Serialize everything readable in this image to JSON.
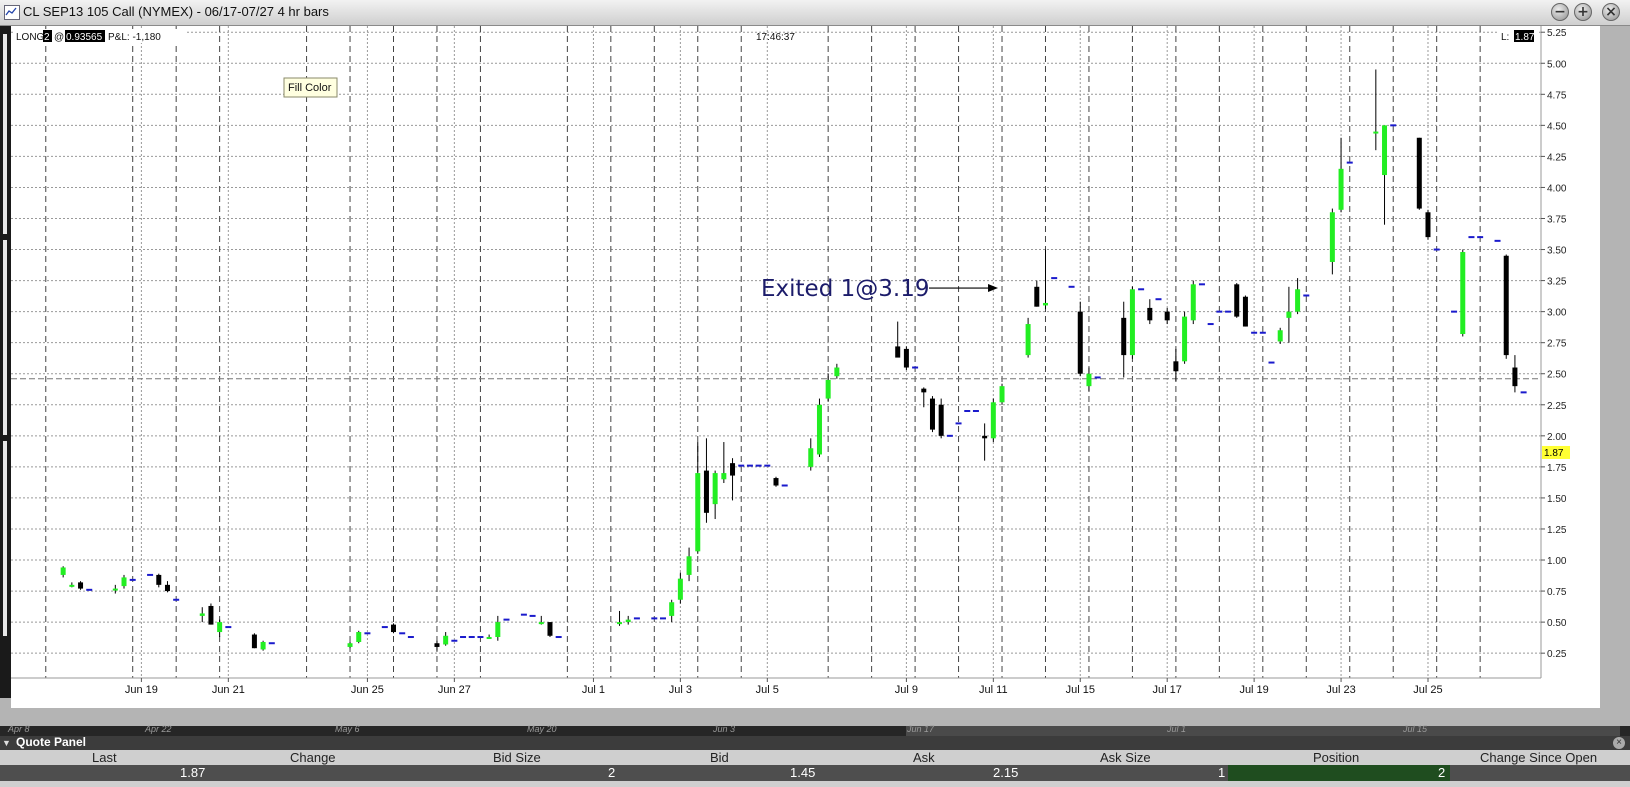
{
  "window": {
    "title": "CL SEP13 105 Call (NYMEX) - 06/17-07/27 4 hr bars",
    "buttons": {
      "minimize": "−",
      "maximize": "+",
      "close": "×"
    }
  },
  "chart_header": {
    "position_prefix": "LONG",
    "position_qty": "2",
    "at": "@",
    "avg_price": "0.93565",
    "pnl": "P&L: -1,180",
    "time": "17:46:37",
    "last_label": "L:",
    "last_value": "1.87"
  },
  "tooltip": "Fill Color",
  "annotation": {
    "text": "Exited 1@3.19",
    "x": 54,
    "y": 3.19
  },
  "chart_data": {
    "type": "candlestick",
    "y_ticks": [
      0.25,
      0.5,
      0.75,
      1.0,
      1.25,
      1.5,
      1.75,
      2.0,
      2.25,
      2.5,
      2.75,
      3.0,
      3.25,
      3.5,
      3.75,
      4.0,
      4.25,
      4.5,
      4.75,
      5.0,
      5.25
    ],
    "y_tick_labels": [
      "0.25",
      "0.50",
      "0.75",
      "1.00",
      "1.25",
      "1.50",
      "1.75",
      "2.00",
      "2.25",
      "2.50",
      "2.75",
      "3.00",
      "3.25",
      "3.50",
      "3.75",
      "4.00",
      "4.25",
      "4.50",
      "4.75",
      "5.00",
      "5.25"
    ],
    "ylim": [
      0.05,
      5.3
    ],
    "x_range": [
      -3,
      85
    ],
    "x_tick_labels": [
      {
        "label": "Jun 19",
        "x": 4.5
      },
      {
        "label": "Jun 21",
        "x": 9.5
      },
      {
        "label": "Jun 25",
        "x": 17.5
      },
      {
        "label": "Jun 27",
        "x": 22.5
      },
      {
        "label": "Jul 1",
        "x": 30.5
      },
      {
        "label": "Jul 3",
        "x": 35.5
      },
      {
        "label": "Jul 5",
        "x": 40.5
      },
      {
        "label": "Jul 9",
        "x": 48.5
      },
      {
        "label": "Jul 11",
        "x": 53.5
      },
      {
        "label": "Jul 15",
        "x": 58.5
      },
      {
        "label": "Jul 17",
        "x": 63.5
      },
      {
        "label": "Jul 19",
        "x": 68.5
      },
      {
        "label": "Jul 23",
        "x": 73.5
      },
      {
        "label": "Jul 25",
        "x": 78.5
      }
    ],
    "vgrid_dashed": [
      -1,
      4,
      6.5,
      9,
      14,
      16.5,
      19,
      21.5,
      24,
      29,
      31.5,
      34,
      36.5,
      39,
      44,
      46.5,
      49,
      51.5,
      54,
      56.5,
      59,
      61.5,
      64,
      66.5,
      69,
      71.5,
      74,
      76.5,
      79,
      81.5
    ],
    "hline": 2.46,
    "up_color": "#22ee22",
    "down_color": "#000000",
    "flat_color": "#1a1acc",
    "bars": [
      {
        "x": 0,
        "o": 0.88,
        "h": 0.95,
        "l": 0.86,
        "c": 0.94
      },
      {
        "x": 0.5,
        "o": 0.8,
        "h": 0.82,
        "l": 0.78,
        "c": 0.8
      },
      {
        "x": 1,
        "o": 0.82,
        "h": 0.83,
        "l": 0.76,
        "c": 0.77
      },
      {
        "x": 1.5,
        "o": 0.76,
        "h": 0.77,
        "l": 0.75,
        "c": 0.76
      },
      {
        "x": 3,
        "o": 0.77,
        "h": 0.8,
        "l": 0.73,
        "c": 0.77
      },
      {
        "x": 3.5,
        "o": 0.79,
        "h": 0.88,
        "l": 0.77,
        "c": 0.86
      },
      {
        "x": 4,
        "o": 0.84,
        "h": 0.85,
        "l": 0.83,
        "c": 0.84
      },
      {
        "x": 5,
        "o": 0.88,
        "h": 0.89,
        "l": 0.87,
        "c": 0.88
      },
      {
        "x": 5.5,
        "o": 0.88,
        "h": 0.89,
        "l": 0.78,
        "c": 0.8
      },
      {
        "x": 6,
        "o": 0.8,
        "h": 0.83,
        "l": 0.74,
        "c": 0.75
      },
      {
        "x": 6.5,
        "o": 0.68,
        "h": 0.69,
        "l": 0.67,
        "c": 0.68
      },
      {
        "x": 8,
        "o": 0.55,
        "h": 0.62,
        "l": 0.5,
        "c": 0.57
      },
      {
        "x": 8.5,
        "o": 0.63,
        "h": 0.65,
        "l": 0.48,
        "c": 0.48
      },
      {
        "x": 9,
        "o": 0.42,
        "h": 0.52,
        "l": 0.38,
        "c": 0.5
      },
      {
        "x": 9.5,
        "o": 0.46,
        "h": 0.47,
        "l": 0.45,
        "c": 0.46
      },
      {
        "x": 11,
        "o": 0.4,
        "h": 0.41,
        "l": 0.29,
        "c": 0.29
      },
      {
        "x": 11.5,
        "o": 0.28,
        "h": 0.35,
        "l": 0.27,
        "c": 0.34
      },
      {
        "x": 12,
        "o": 0.33,
        "h": 0.34,
        "l": 0.32,
        "c": 0.33
      },
      {
        "x": 16.5,
        "o": 0.3,
        "h": 0.34,
        "l": 0.29,
        "c": 0.33
      },
      {
        "x": 17,
        "o": 0.34,
        "h": 0.43,
        "l": 0.33,
        "c": 0.42
      },
      {
        "x": 17.5,
        "o": 0.41,
        "h": 0.42,
        "l": 0.4,
        "c": 0.41
      },
      {
        "x": 18.5,
        "o": 0.46,
        "h": 0.47,
        "l": 0.45,
        "c": 0.46
      },
      {
        "x": 19,
        "o": 0.48,
        "h": 0.49,
        "l": 0.41,
        "c": 0.42
      },
      {
        "x": 19.5,
        "o": 0.41,
        "h": 0.42,
        "l": 0.4,
        "c": 0.41
      },
      {
        "x": 20,
        "o": 0.38,
        "h": 0.39,
        "l": 0.37,
        "c": 0.38
      },
      {
        "x": 21.5,
        "o": 0.33,
        "h": 0.35,
        "l": 0.27,
        "c": 0.3
      },
      {
        "x": 22,
        "o": 0.32,
        "h": 0.42,
        "l": 0.31,
        "c": 0.39
      },
      {
        "x": 22.5,
        "o": 0.35,
        "h": 0.36,
        "l": 0.34,
        "c": 0.35
      },
      {
        "x": 23,
        "o": 0.38,
        "h": 0.39,
        "l": 0.37,
        "c": 0.38
      },
      {
        "x": 23.5,
        "o": 0.38,
        "h": 0.39,
        "l": 0.37,
        "c": 0.38
      },
      {
        "x": 24,
        "o": 0.38,
        "h": 0.39,
        "l": 0.37,
        "c": 0.38
      },
      {
        "x": 24.5,
        "o": 0.38,
        "h": 0.4,
        "l": 0.37,
        "c": 0.38
      },
      {
        "x": 25,
        "o": 0.38,
        "h": 0.55,
        "l": 0.35,
        "c": 0.5
      },
      {
        "x": 25.5,
        "o": 0.52,
        "h": 0.53,
        "l": 0.51,
        "c": 0.52
      },
      {
        "x": 26.5,
        "o": 0.56,
        "h": 0.57,
        "l": 0.55,
        "c": 0.56
      },
      {
        "x": 27,
        "o": 0.55,
        "h": 0.56,
        "l": 0.54,
        "c": 0.55
      },
      {
        "x": 27.5,
        "o": 0.5,
        "h": 0.55,
        "l": 0.48,
        "c": 0.5
      },
      {
        "x": 28,
        "o": 0.5,
        "h": 0.5,
        "l": 0.38,
        "c": 0.39
      },
      {
        "x": 28.5,
        "o": 0.38,
        "h": 0.39,
        "l": 0.37,
        "c": 0.38
      },
      {
        "x": 32,
        "o": 0.49,
        "h": 0.59,
        "l": 0.47,
        "c": 0.5
      },
      {
        "x": 32.5,
        "o": 0.5,
        "h": 0.55,
        "l": 0.48,
        "c": 0.52
      },
      {
        "x": 33,
        "o": 0.53,
        "h": 0.54,
        "l": 0.52,
        "c": 0.53
      },
      {
        "x": 34,
        "o": 0.53,
        "h": 0.54,
        "l": 0.52,
        "c": 0.53
      },
      {
        "x": 34.5,
        "o": 0.53,
        "h": 0.54,
        "l": 0.52,
        "c": 0.53
      },
      {
        "x": 35,
        "o": 0.55,
        "h": 0.68,
        "l": 0.5,
        "c": 0.66
      },
      {
        "x": 35.5,
        "o": 0.68,
        "h": 0.9,
        "l": 0.65,
        "c": 0.85
      },
      {
        "x": 36,
        "o": 0.88,
        "h": 1.1,
        "l": 0.83,
        "c": 1.03
      },
      {
        "x": 36.5,
        "o": 1.07,
        "h": 1.95,
        "l": 1.05,
        "c": 1.7
      },
      {
        "x": 37,
        "o": 1.72,
        "h": 1.98,
        "l": 1.3,
        "c": 1.38
      },
      {
        "x": 37.5,
        "o": 1.45,
        "h": 1.72,
        "l": 1.33,
        "c": 1.7
      },
      {
        "x": 38,
        "o": 1.65,
        "h": 1.95,
        "l": 1.62,
        "c": 1.7
      },
      {
        "x": 38.5,
        "o": 1.78,
        "h": 1.82,
        "l": 1.48,
        "c": 1.68
      },
      {
        "x": 39,
        "o": 1.76,
        "h": 1.77,
        "l": 1.75,
        "c": 1.76
      },
      {
        "x": 39.5,
        "o": 1.76,
        "h": 1.77,
        "l": 1.75,
        "c": 1.76
      },
      {
        "x": 40,
        "o": 1.76,
        "h": 1.77,
        "l": 1.75,
        "c": 1.76
      },
      {
        "x": 40.5,
        "o": 1.76,
        "h": 1.77,
        "l": 1.75,
        "c": 1.76
      },
      {
        "x": 41,
        "o": 1.66,
        "h": 1.67,
        "l": 1.59,
        "c": 1.6
      },
      {
        "x": 41.5,
        "o": 1.6,
        "h": 1.61,
        "l": 1.59,
        "c": 1.6
      },
      {
        "x": 43,
        "o": 1.75,
        "h": 1.98,
        "l": 1.72,
        "c": 1.9
      },
      {
        "x": 43.5,
        "o": 1.85,
        "h": 2.3,
        "l": 1.83,
        "c": 2.25
      },
      {
        "x": 44,
        "o": 2.3,
        "h": 2.5,
        "l": 2.28,
        "c": 2.45
      },
      {
        "x": 44.5,
        "o": 2.48,
        "h": 2.58,
        "l": 2.46,
        "c": 2.55
      },
      {
        "x": 48,
        "o": 2.72,
        "h": 2.92,
        "l": 2.7,
        "c": 2.63
      },
      {
        "x": 48.5,
        "o": 2.7,
        "h": 2.72,
        "l": 2.53,
        "c": 2.55
      },
      {
        "x": 49,
        "o": 2.55,
        "h": 2.56,
        "l": 2.54,
        "c": 2.55
      },
      {
        "x": 49.5,
        "o": 2.38,
        "h": 2.39,
        "l": 2.23,
        "c": 2.35
      },
      {
        "x": 50,
        "o": 2.3,
        "h": 2.32,
        "l": 2.03,
        "c": 2.05
      },
      {
        "x": 50.5,
        "o": 2.25,
        "h": 2.3,
        "l": 1.98,
        "c": 2.0
      },
      {
        "x": 51,
        "o": 2.0,
        "h": 2.01,
        "l": 1.99,
        "c": 2.0
      },
      {
        "x": 51.5,
        "o": 2.1,
        "h": 2.11,
        "l": 2.09,
        "c": 2.1
      },
      {
        "x": 52,
        "o": 2.2,
        "h": 2.21,
        "l": 2.19,
        "c": 2.2
      },
      {
        "x": 52.5,
        "o": 2.2,
        "h": 2.21,
        "l": 2.19,
        "c": 2.2
      },
      {
        "x": 53,
        "o": 2.0,
        "h": 2.1,
        "l": 1.8,
        "c": 1.98
      },
      {
        "x": 53.5,
        "o": 1.98,
        "h": 2.3,
        "l": 1.95,
        "c": 2.27
      },
      {
        "x": 54,
        "o": 2.27,
        "h": 2.42,
        "l": 2.25,
        "c": 2.4
      },
      {
        "x": 55.5,
        "o": 2.65,
        "h": 2.95,
        "l": 2.63,
        "c": 2.9
      },
      {
        "x": 56,
        "o": 3.2,
        "h": 3.25,
        "l": 3.04,
        "c": 3.04
      },
      {
        "x": 56.5,
        "o": 3.05,
        "h": 3.5,
        "l": 3.02,
        "c": 3.07
      },
      {
        "x": 57,
        "o": 3.27,
        "h": 3.28,
        "l": 3.26,
        "c": 3.27
      },
      {
        "x": 58,
        "o": 3.2,
        "h": 3.21,
        "l": 3.19,
        "c": 3.2
      },
      {
        "x": 58.5,
        "o": 3.0,
        "h": 3.08,
        "l": 2.48,
        "c": 2.5
      },
      {
        "x": 59,
        "o": 2.4,
        "h": 2.55,
        "l": 2.36,
        "c": 2.5
      },
      {
        "x": 59.5,
        "o": 2.47,
        "h": 2.48,
        "l": 2.46,
        "c": 2.47
      },
      {
        "x": 61,
        "o": 2.95,
        "h": 3.08,
        "l": 2.47,
        "c": 2.65
      },
      {
        "x": 61.5,
        "o": 2.65,
        "h": 3.2,
        "l": 2.62,
        "c": 3.18
      },
      {
        "x": 62,
        "o": 3.18,
        "h": 3.19,
        "l": 3.17,
        "c": 3.18
      },
      {
        "x": 62.5,
        "o": 3.03,
        "h": 3.1,
        "l": 2.9,
        "c": 2.93
      },
      {
        "x": 63,
        "o": 3.1,
        "h": 3.11,
        "l": 3.09,
        "c": 3.1
      },
      {
        "x": 63.5,
        "o": 3.0,
        "h": 3.03,
        "l": 2.9,
        "c": 2.93
      },
      {
        "x": 64,
        "o": 2.6,
        "h": 2.7,
        "l": 2.44,
        "c": 2.52
      },
      {
        "x": 64.5,
        "o": 2.6,
        "h": 3.0,
        "l": 2.58,
        "c": 2.96
      },
      {
        "x": 65,
        "o": 2.93,
        "h": 3.25,
        "l": 2.9,
        "c": 3.22
      },
      {
        "x": 65.5,
        "o": 3.22,
        "h": 3.23,
        "l": 3.21,
        "c": 3.22
      },
      {
        "x": 66,
        "o": 2.9,
        "h": 2.91,
        "l": 2.89,
        "c": 2.9
      },
      {
        "x": 66.5,
        "o": 3.0,
        "h": 3.01,
        "l": 2.99,
        "c": 3.0
      },
      {
        "x": 67,
        "o": 3.0,
        "h": 3.01,
        "l": 2.99,
        "c": 3.0
      },
      {
        "x": 67.5,
        "o": 3.22,
        "h": 3.23,
        "l": 2.95,
        "c": 2.96
      },
      {
        "x": 68,
        "o": 3.12,
        "h": 3.13,
        "l": 2.88,
        "c": 2.88
      },
      {
        "x": 68.5,
        "o": 2.83,
        "h": 2.84,
        "l": 2.82,
        "c": 2.83
      },
      {
        "x": 69,
        "o": 2.83,
        "h": 2.84,
        "l": 2.82,
        "c": 2.83
      },
      {
        "x": 69.5,
        "o": 2.59,
        "h": 2.6,
        "l": 2.58,
        "c": 2.59
      },
      {
        "x": 70,
        "o": 2.76,
        "h": 2.87,
        "l": 2.74,
        "c": 2.85
      },
      {
        "x": 70.5,
        "o": 2.95,
        "h": 3.2,
        "l": 2.75,
        "c": 3.0
      },
      {
        "x": 71,
        "o": 3.0,
        "h": 3.27,
        "l": 2.98,
        "c": 3.18
      },
      {
        "x": 71.5,
        "o": 3.13,
        "h": 3.14,
        "l": 3.12,
        "c": 3.13
      },
      {
        "x": 73,
        "o": 3.4,
        "h": 3.83,
        "l": 3.3,
        "c": 3.8
      },
      {
        "x": 73.5,
        "o": 3.82,
        "h": 4.4,
        "l": 3.8,
        "c": 4.15
      },
      {
        "x": 74,
        "o": 4.2,
        "h": 4.21,
        "l": 4.19,
        "c": 4.2
      },
      {
        "x": 75.5,
        "o": 4.45,
        "h": 4.95,
        "l": 4.3,
        "c": 4.45
      },
      {
        "x": 76,
        "o": 4.1,
        "h": 4.5,
        "l": 3.7,
        "c": 4.5
      },
      {
        "x": 76.5,
        "o": 4.5,
        "h": 4.51,
        "l": 4.49,
        "c": 4.5
      },
      {
        "x": 78,
        "o": 4.4,
        "h": 4.4,
        "l": 3.82,
        "c": 3.83
      },
      {
        "x": 78.5,
        "o": 3.8,
        "h": 3.82,
        "l": 3.58,
        "c": 3.6
      },
      {
        "x": 79,
        "o": 3.5,
        "h": 3.51,
        "l": 3.49,
        "c": 3.5
      },
      {
        "x": 80,
        "o": 3.0,
        "h": 3.01,
        "l": 2.99,
        "c": 3.0
      },
      {
        "x": 80.5,
        "o": 2.82,
        "h": 3.5,
        "l": 2.8,
        "c": 3.48
      },
      {
        "x": 81,
        "o": 3.6,
        "h": 3.61,
        "l": 3.59,
        "c": 3.6
      },
      {
        "x": 81.5,
        "o": 3.6,
        "h": 3.61,
        "l": 3.59,
        "c": 3.6
      },
      {
        "x": 82.5,
        "o": 3.57,
        "h": 3.58,
        "l": 3.56,
        "c": 3.57
      },
      {
        "x": 83,
        "o": 3.45,
        "h": 3.46,
        "l": 2.62,
        "c": 2.65
      },
      {
        "x": 83.5,
        "o": 2.55,
        "h": 2.65,
        "l": 2.35,
        "c": 2.4
      },
      {
        "x": 84,
        "o": 2.35,
        "h": 2.36,
        "l": 2.34,
        "c": 2.35
      }
    ]
  },
  "quote_panel": {
    "title": "Quote Panel",
    "labels": [
      "Last",
      "Change",
      "Bid Size",
      "Bid",
      "Ask",
      "Ask Size",
      "Position",
      "Change Since Open"
    ],
    "values": [
      "1.87",
      "",
      "2",
      "1.45",
      "2.15",
      "1",
      "2",
      ""
    ]
  },
  "timeline_labels": [
    "Apr 8",
    "Apr 22",
    "May 6",
    "May 20",
    "Jun 3",
    "Jun 17",
    "Jul 1",
    "Jul 15"
  ]
}
